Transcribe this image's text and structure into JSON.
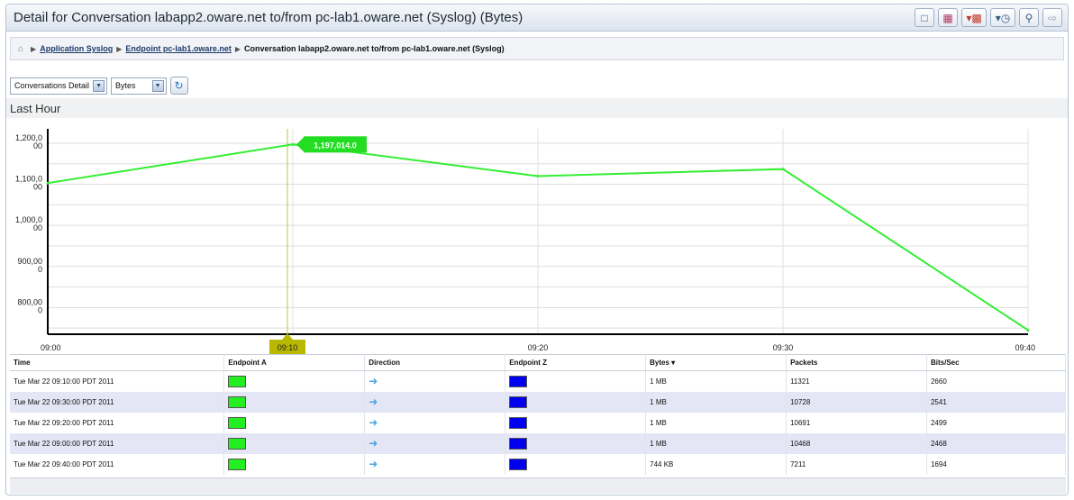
{
  "title": "Detail for Conversation labapp2.oware.net to/from pc-lab1.oware.net (Syslog) (Bytes)",
  "toolbar": [
    "document-icon",
    "save-icon",
    "chart-type-icon",
    "history-icon",
    "search-icon",
    "export-icon"
  ],
  "breadcrumb": {
    "home": "⌂",
    "items": [
      "Application Syslog",
      "Endpoint pc-lab1.oware.net"
    ],
    "current": "Conversation labapp2.oware.net to/from pc-lab1.oware.net (Syslog)"
  },
  "controls": {
    "view": "Conversations Detail",
    "metric": "Bytes"
  },
  "subheader": "Last Hour",
  "chart_data": {
    "type": "line",
    "x": [
      "09:00",
      "09:10",
      "09:20",
      "09:30",
      "09:40"
    ],
    "x_ticks": [
      "09:00",
      "09:10",
      "09:20",
      "09:30",
      "09:40"
    ],
    "series": [
      {
        "values": [
          1103000,
          1197014,
          1120000,
          1137000,
          745000
        ],
        "color": "#33ee33"
      }
    ],
    "y_ticks": [
      [
        "1,200,0",
        "00"
      ],
      [
        "1,100,0",
        "00"
      ],
      [
        "1,000,0",
        "00"
      ],
      [
        "900,00",
        "0"
      ],
      [
        "800,00",
        "0"
      ]
    ],
    "y_tick_values": [
      1200000,
      1100000,
      1000000,
      900000,
      800000
    ],
    "ylim": [
      735000,
      1235000
    ],
    "highlight": {
      "x": "09:10",
      "label": "1,197,014.0"
    }
  },
  "table": {
    "columns": [
      "Time",
      "Endpoint A",
      "Direction",
      "Endpoint Z",
      "Bytes ▾",
      "Packets",
      "Bits/Sec"
    ],
    "rows": [
      {
        "time": "Tue Mar 22 09:10:00 PDT 2011",
        "bytes": "1 MB",
        "packets": "11321",
        "bps": "2660"
      },
      {
        "time": "Tue Mar 22 09:30:00 PDT 2011",
        "bytes": "1 MB",
        "packets": "10728",
        "bps": "2541"
      },
      {
        "time": "Tue Mar 22 09:20:00 PDT 2011",
        "bytes": "1 MB",
        "packets": "10691",
        "bps": "2499"
      },
      {
        "time": "Tue Mar 22 09:00:00 PDT 2011",
        "bytes": "1 MB",
        "packets": "10468",
        "bps": "2468"
      },
      {
        "time": "Tue Mar 22 09:40:00 PDT 2011",
        "bytes": "744 KB",
        "packets": "7211",
        "bps": "1694"
      }
    ],
    "endpoint_a_color": "#22ee22",
    "endpoint_z_color": "#0000ee",
    "direction_icon": "right-arrow-icon"
  }
}
